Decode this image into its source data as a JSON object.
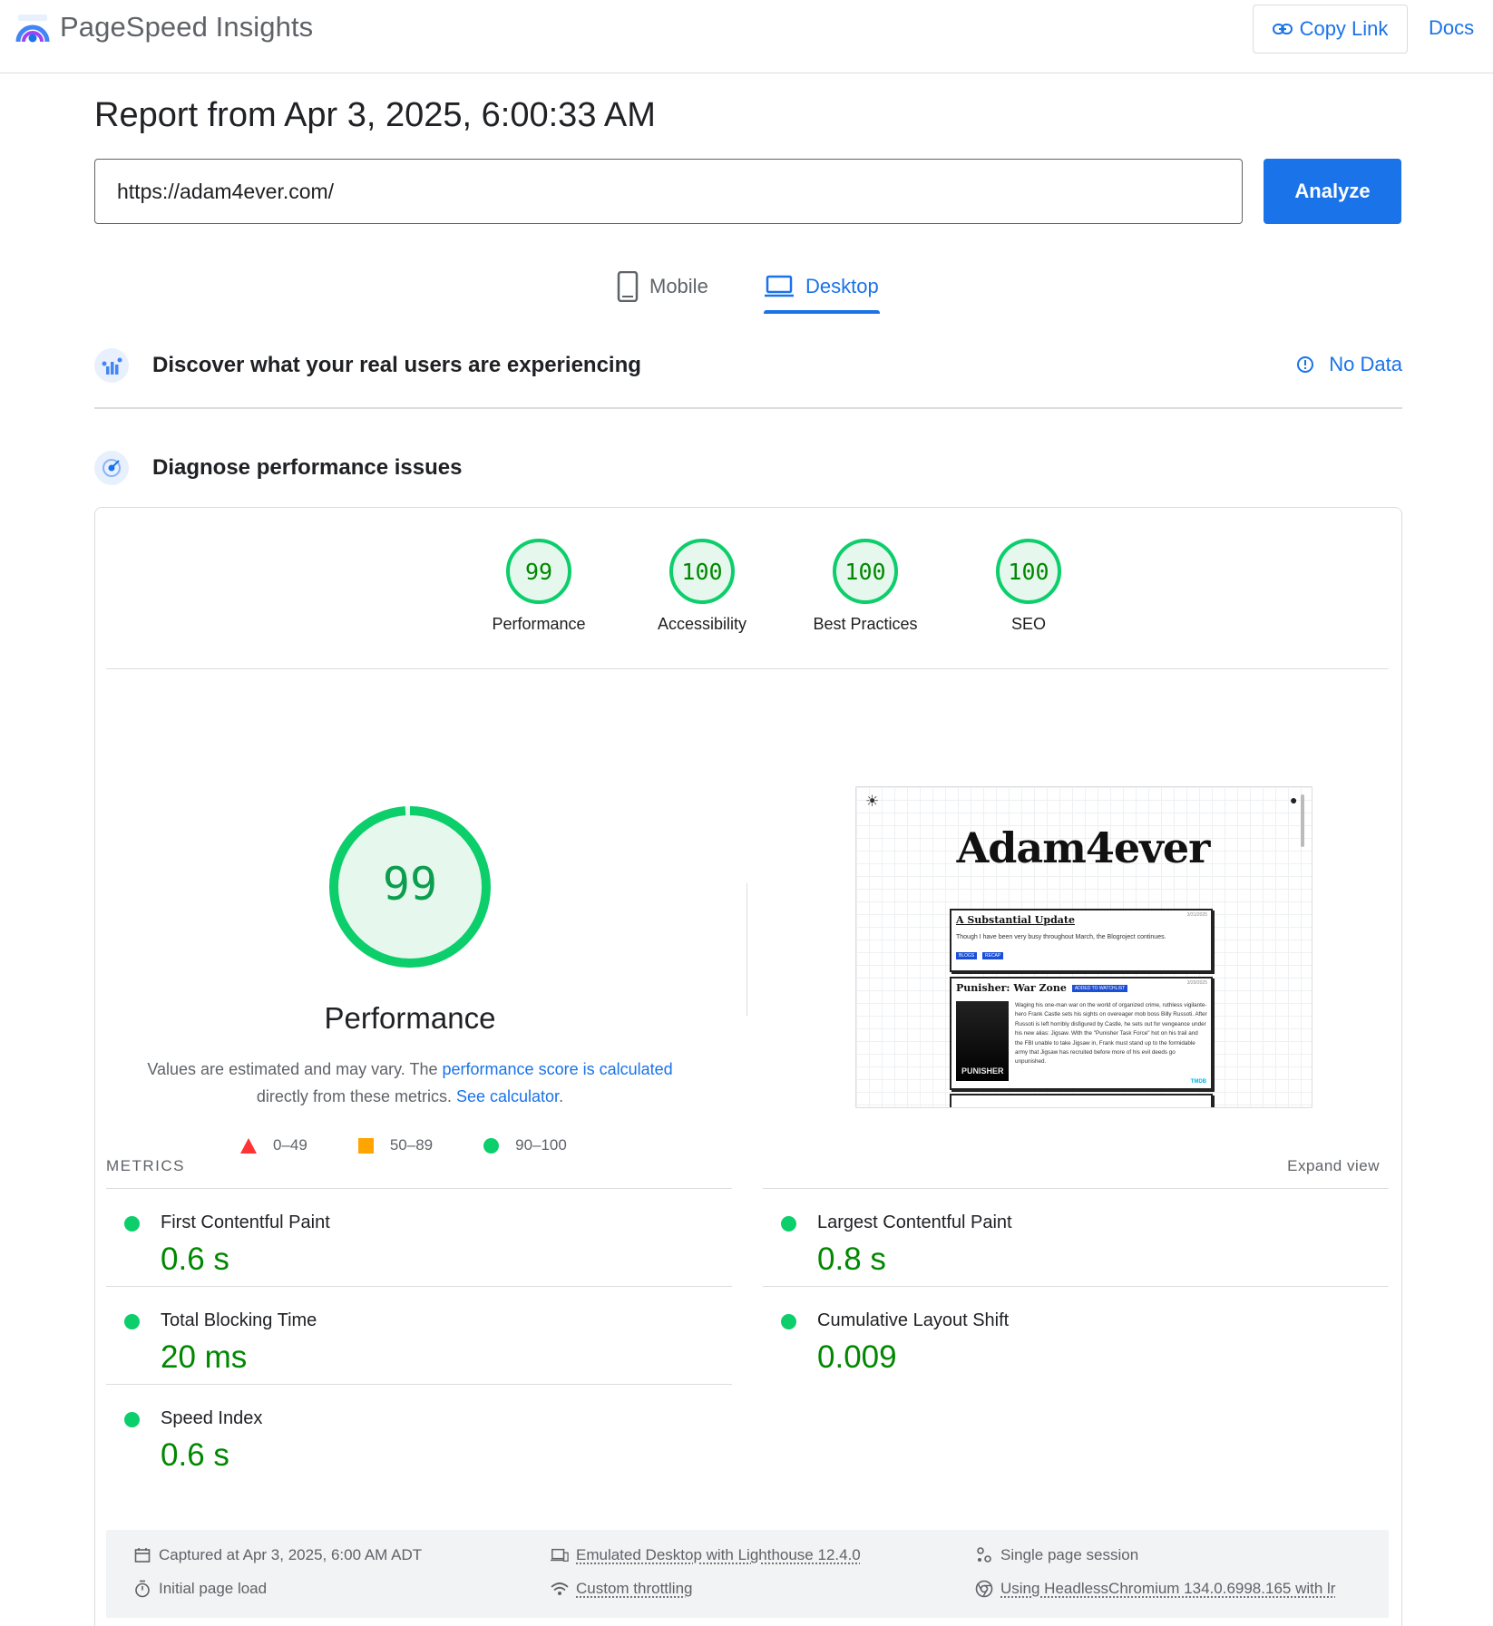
{
  "app": {
    "title": "PageSpeed Insights"
  },
  "header": {
    "copy_link_label": "Copy Link",
    "docs_label": "Docs"
  },
  "report": {
    "title": "Report from Apr 3, 2025, 6:00:33 AM"
  },
  "url_input": {
    "value": "https://adam4ever.com/",
    "analyze_label": "Analyze"
  },
  "tabs": [
    {
      "label": "Mobile",
      "selected": false
    },
    {
      "label": "Desktop",
      "selected": true
    }
  ],
  "field_data": {
    "title": "Discover what your real users are experiencing",
    "status": "No Data"
  },
  "diagnose": {
    "title": "Diagnose performance issues"
  },
  "categories": [
    {
      "score": "99",
      "label": "Performance"
    },
    {
      "score": "100",
      "label": "Accessibility"
    },
    {
      "score": "100",
      "label": "Best Practices"
    },
    {
      "score": "100",
      "label": "SEO"
    }
  ],
  "performance": {
    "score": "99",
    "score_fraction": 0.99,
    "title": "Performance",
    "note_prefix": "Values are estimated and may vary. The ",
    "note_link": "performance score is calculated",
    "note_middle": "directly from these metrics. ",
    "note_link2": "See calculator",
    "note_suffix": "."
  },
  "legend": [
    {
      "shape": "triangle",
      "range": "0–49",
      "color": "#ff3333"
    },
    {
      "shape": "square",
      "range": "50–89",
      "color": "#ffa400"
    },
    {
      "shape": "circle",
      "range": "90–100",
      "color": "#0cce6b"
    }
  ],
  "screenshot": {
    "site_title": "Adam4ever",
    "posts": [
      {
        "title": "A Substantial Update",
        "date": "3/31/2025",
        "excerpt": "Though I have been very busy throughout March, the Blogroject continues.",
        "tags": [
          "BLOGS",
          "RECAP"
        ]
      },
      {
        "title": "Punisher: War Zone",
        "date": "3/29/2025",
        "badge": "ADDED TO WATCHLIST",
        "poster_text": "PUNISHER",
        "body": "Waging his one-man war on the world of organized crime, ruthless vigilante-hero Frank Castle sets his sights on overeager mob boss Billy Russoti. After Russoti is left horribly disfigured by Castle, he sets out for vengeance under his new alias: Jigsaw. With the \"Punisher Task Force\" hot on his trail and the FBI unable to take Jigsaw in, Frank must stand up to the formidable army that Jigsaw has recruited before more of his evil deeds go unpunished.",
        "source": "TMDB"
      }
    ]
  },
  "metrics": {
    "header": "METRICS",
    "expand_label": "Expand view",
    "items": [
      {
        "label": "First Contentful Paint",
        "value": "0.6 s"
      },
      {
        "label": "Largest Contentful Paint",
        "value": "0.8 s"
      },
      {
        "label": "Total Blocking Time",
        "value": "20 ms"
      },
      {
        "label": "Cumulative Layout Shift",
        "value": "0.009"
      },
      {
        "label": "Speed Index",
        "value": "0.6 s"
      }
    ]
  },
  "run_info": {
    "captured": "Captured at Apr 3, 2025, 6:00 AM ADT",
    "emulated": "Emulated Desktop with Lighthouse 12.4.0",
    "session": "Single page session",
    "page_load": "Initial page load",
    "throttling": "Custom throttling",
    "browser": "Using HeadlessChromium 134.0.6998.165 with lr"
  },
  "colors": {
    "accent": "#1a73e8",
    "pass": "#0cce6b",
    "pass_text": "#008800"
  }
}
